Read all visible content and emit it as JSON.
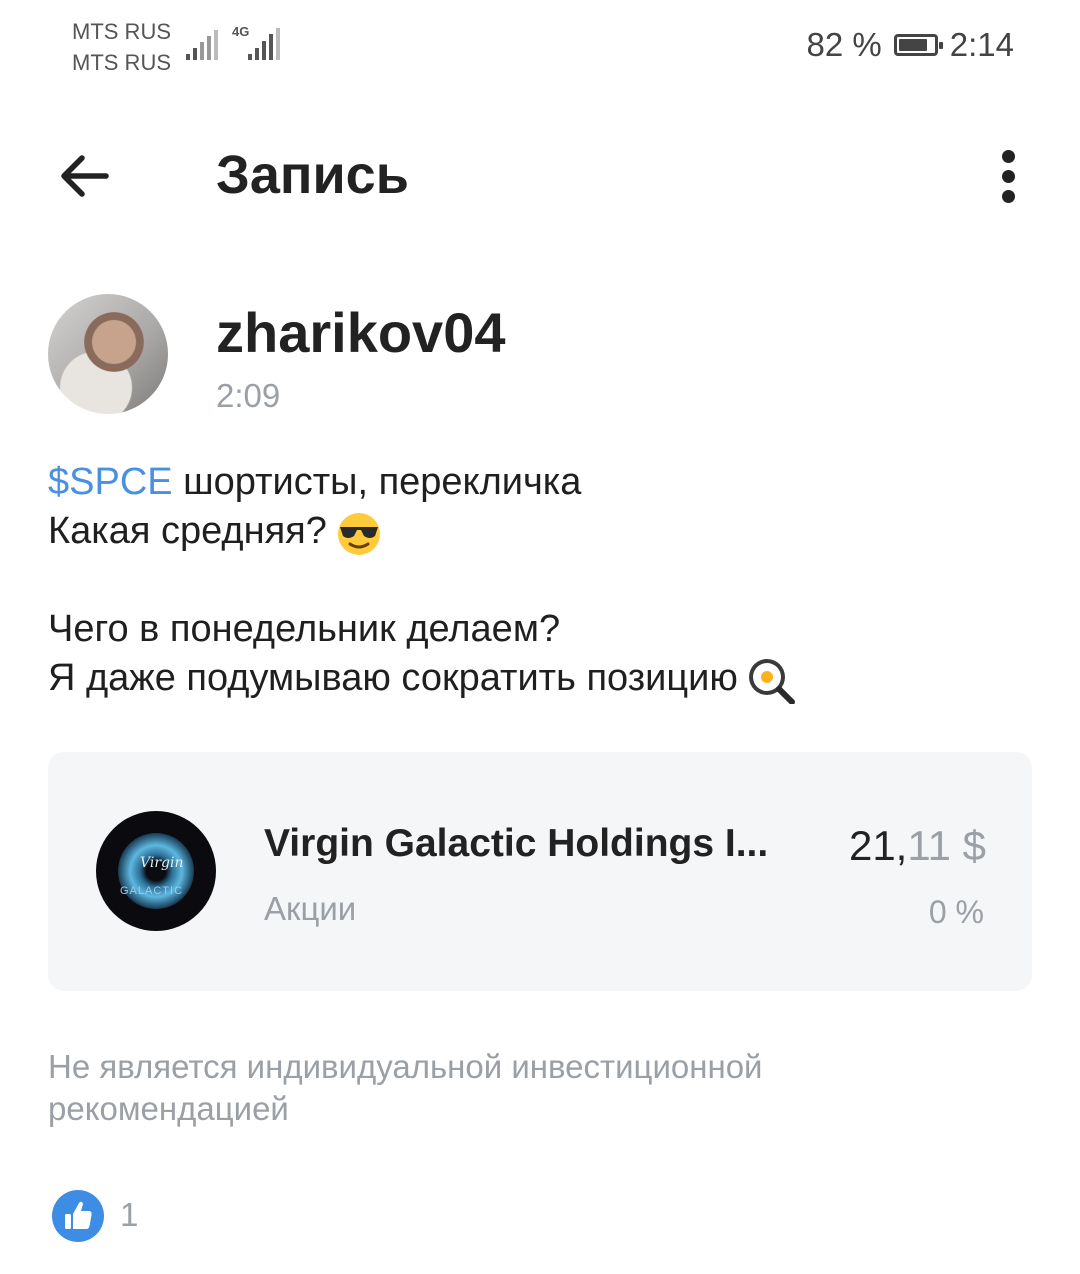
{
  "status_bar": {
    "carrier1": "MTS RUS",
    "carrier2": "MTS RUS",
    "network": "4G",
    "battery": "82 %",
    "battery_level": 0.82,
    "time": "2:14"
  },
  "header": {
    "title": "Запись",
    "back_icon": "arrow-left-icon",
    "menu_icon": "more-vertical-icon"
  },
  "author": {
    "username": "zharikov04",
    "time": "2:09"
  },
  "post": {
    "ticker": "$SPCE",
    "line1_rest": " шортисты, перекличка",
    "line2": "Какая средняя?",
    "line2_emoji": "sunglasses-face-emoji",
    "line3": "Чего в понедельник делаем?",
    "line4": "Я даже подумываю сократить позицию",
    "line4_emoji": "frying-pan-egg-emoji"
  },
  "instrument": {
    "name": "Virgin Galactic Holdings I...",
    "type": "Акции",
    "price_int": "21,",
    "price_frac": "11",
    "currency": " $",
    "change": "0 %",
    "logo": "virgin-galactic-logo"
  },
  "disclaimer": "Не является индивидуальной инвестиционной рекомендацией",
  "likes": {
    "icon": "thumbs-up-icon",
    "count": "1",
    "color": "#3d8de5"
  },
  "colors": {
    "accent": "#4a90e2",
    "muted": "#9aa0a6",
    "card_bg": "#f5f6f8"
  }
}
